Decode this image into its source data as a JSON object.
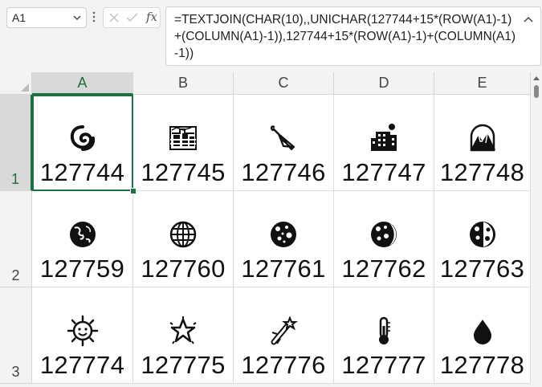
{
  "namebox": {
    "value": "A1"
  },
  "formula_bar": {
    "fx_label": "fx",
    "text": "=TEXTJOIN(CHAR(10),,UNICHAR(127744+15*(ROW(A1)-1)+(COLUMN(A1)-1)),127744+15*(ROW(A1)-1)+(COLUMN(A1)-1))"
  },
  "columns": [
    "A",
    "B",
    "C",
    "D",
    "E"
  ],
  "rows": [
    {
      "label": "1",
      "cells": [
        {
          "icon": "cyclone-icon",
          "value": "127744"
        },
        {
          "icon": "foggy-icon",
          "value": "127745"
        },
        {
          "icon": "closed-umbrella-icon",
          "value": "127746"
        },
        {
          "icon": "night-with-stars-icon",
          "value": "127747"
        },
        {
          "icon": "sunrise-over-mountains-icon",
          "value": "127748"
        }
      ]
    },
    {
      "label": "2",
      "cells": [
        {
          "icon": "earth-globe-asia-australia-icon",
          "value": "127759"
        },
        {
          "icon": "globe-with-meridians-icon",
          "value": "127760"
        },
        {
          "icon": "new-moon-symbol-icon",
          "value": "127761"
        },
        {
          "icon": "waxing-crescent-moon-icon",
          "value": "127762"
        },
        {
          "icon": "first-quarter-moon-icon",
          "value": "127763"
        }
      ]
    },
    {
      "label": "3",
      "cells": [
        {
          "icon": "sun-with-face-icon",
          "value": "127774"
        },
        {
          "icon": "glowing-star-icon",
          "value": "127775"
        },
        {
          "icon": "shooting-star-icon",
          "value": "127776"
        },
        {
          "icon": "thermometer-icon",
          "value": "127777"
        },
        {
          "icon": "black-droplet-icon",
          "value": "127778"
        }
      ]
    }
  ],
  "selection": {
    "cell": "A1",
    "accent_color": "#1e7145"
  }
}
